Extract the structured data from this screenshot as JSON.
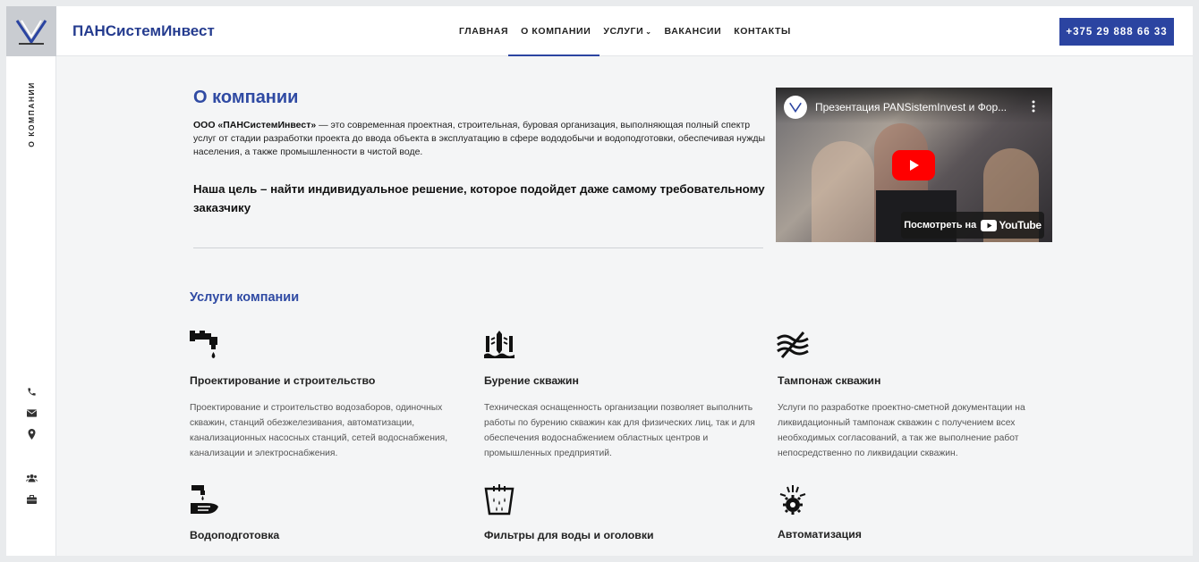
{
  "header": {
    "brand": "ПАНСистемИнвест",
    "nav": [
      {
        "label": "ГЛАВНАЯ"
      },
      {
        "label": "О КОМПАНИИ"
      },
      {
        "label": "УСЛУГИ"
      },
      {
        "label": "ВАКАНСИИ"
      },
      {
        "label": "КОНТАКТЫ"
      }
    ],
    "active_nav": "О КОМПАНИИ",
    "phone": "+375 29 888 66 33"
  },
  "sidebar": {
    "label": "О КОМПАНИИ",
    "icons": [
      "phone-icon",
      "mail-icon",
      "location-icon",
      "users-icon",
      "briefcase-icon"
    ]
  },
  "about": {
    "title": "О компании",
    "intro_company": "ООО «ПАНСистемИнвест»",
    "intro_text": " — это современная проектная, строительная, буровая организация, выполняющая полный спектр услуг от стадии разработки проекта до ввода объекта в эксплуатацию в сфере вододобычи и водоподготовки, обеспечивая нужды населения, а также промышленности в чистой воде.",
    "goal": "Наша цель – найти индивидуальное решение, которое подойдет даже самому требовательному заказчику"
  },
  "video": {
    "title": "Презентация PANSistemInvest и Фор...",
    "watch_label": "Посмотреть на",
    "platform": "YouTube"
  },
  "services": {
    "title": "Услуги компании",
    "items": [
      {
        "title": "Проектирование и строительство",
        "text": "Проектирование и строительство водозаборов, одиночных скважин, станций обезжелезивания, автоматизации, канализационных насосных станций, сетей водоснабжения, канализации и электроснабжения.",
        "icon": "faucet-icon"
      },
      {
        "title": "Бурение скважин",
        "text": "Техническая оснащенность организации позволяет выполнить работы по бурению скважин как для физических лиц, так и для обеспечения водоснабжением областных центров и промышленных предприятий.",
        "icon": "drilling-icon"
      },
      {
        "title": "Тампонаж скважин",
        "text": "Услуги по разработке проектно-сметной документации на ликвидационный тампонаж скважин с получением всех необходимых согласований, а так же выполнение работ непосредственно по ликвидации скважин.",
        "icon": "waves-icon"
      },
      {
        "title": "Водоподготовка",
        "text": "",
        "icon": "hand-water-icon"
      },
      {
        "title": "Фильтры для воды и оголовки",
        "text": "",
        "icon": "filter-icon"
      },
      {
        "title": "Автоматизация",
        "text": "",
        "icon": "gear-icon"
      }
    ]
  },
  "colors": {
    "accent": "#2b44a1",
    "heading": "#2f4aa3",
    "youtube_red": "#ff0000"
  }
}
